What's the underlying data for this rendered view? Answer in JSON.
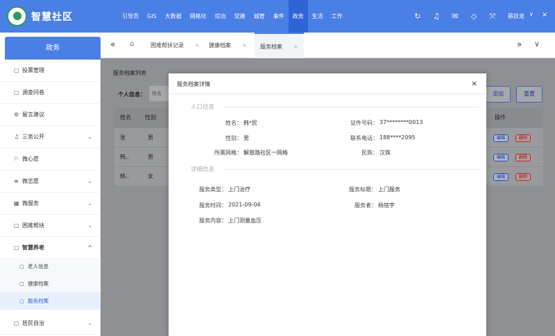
{
  "header": {
    "brand": "智慧社区",
    "nav": [
      "引导页",
      "GIS",
      "大数据",
      "网格化",
      "综治",
      "党建",
      "城管",
      "事件",
      "政务",
      "生活",
      "工作"
    ],
    "active_nav": "政务",
    "user": "蔡跃龙"
  },
  "sidebar": {
    "title": "政务",
    "items": [
      {
        "label": "投票管理",
        "icon": "box-icon"
      },
      {
        "label": "调查问卷",
        "icon": "box-icon"
      },
      {
        "label": "留言建议",
        "icon": "gear-icon"
      },
      {
        "label": "三务公开",
        "icon": "bell-icon",
        "chev": "⌄"
      },
      {
        "label": "微心愿",
        "icon": "flag-icon"
      },
      {
        "label": "微志愿",
        "icon": "stack-icon",
        "chev": "⌄"
      },
      {
        "label": "微服务",
        "icon": "grid-icon",
        "chev": "⌄"
      },
      {
        "label": "困难帮扶",
        "icon": "box-icon",
        "chev": "⌄"
      },
      {
        "label": "智慧养老",
        "icon": "box-icon",
        "chev": "^"
      }
    ],
    "sub_items": [
      {
        "label": "老人信息"
      },
      {
        "label": "健康档案"
      },
      {
        "label": "服务档案"
      }
    ],
    "last_item": {
      "label": "居民自治",
      "chev": "⌄"
    }
  },
  "tabs": {
    "items": [
      {
        "label": "困难帮扶记录"
      },
      {
        "label": "健康档案"
      },
      {
        "label": "服务档案"
      }
    ],
    "active": "服务档案"
  },
  "list": {
    "title": "服务档案列表",
    "filter_label": "个人信息：",
    "filter_placeholder": "姓名",
    "add_label": "添加",
    "reset_label": "重置",
    "columns": [
      "姓名",
      "性别",
      "操作"
    ],
    "rows": [
      {
        "name": "张",
        "gender": "男"
      },
      {
        "name": "韩..",
        "gender": "男"
      },
      {
        "name": "韩..",
        "gender": "女"
      }
    ],
    "edit_label": "编辑",
    "delete_label": "删除"
  },
  "modal": {
    "title": "服务档案详情",
    "section1": "人口信息",
    "section2": "详细信息",
    "fields": {
      "name_label": "姓名：",
      "name_value": "韩*民",
      "id_label": "证件号码：",
      "id_value": "37********0013",
      "gender_label": "性别：",
      "gender_value": "男",
      "phone_label": "联系电话：",
      "phone_value": "188****2095",
      "grid_label": "所属网格：",
      "grid_value": "解放路社区一网格",
      "ethnic_label": "民族：",
      "ethnic_value": "汉族",
      "type_label": "服务类型：",
      "type_value": "上门治疗",
      "subject_label": "服务标题：",
      "subject_value": "上门服务",
      "time_label": "服务时间：",
      "time_value": "2021-09-04",
      "server_label": "服务者：",
      "server_value": "杨铭宇",
      "content_label": "服务内容：",
      "content_value": "上门测量血压"
    }
  }
}
